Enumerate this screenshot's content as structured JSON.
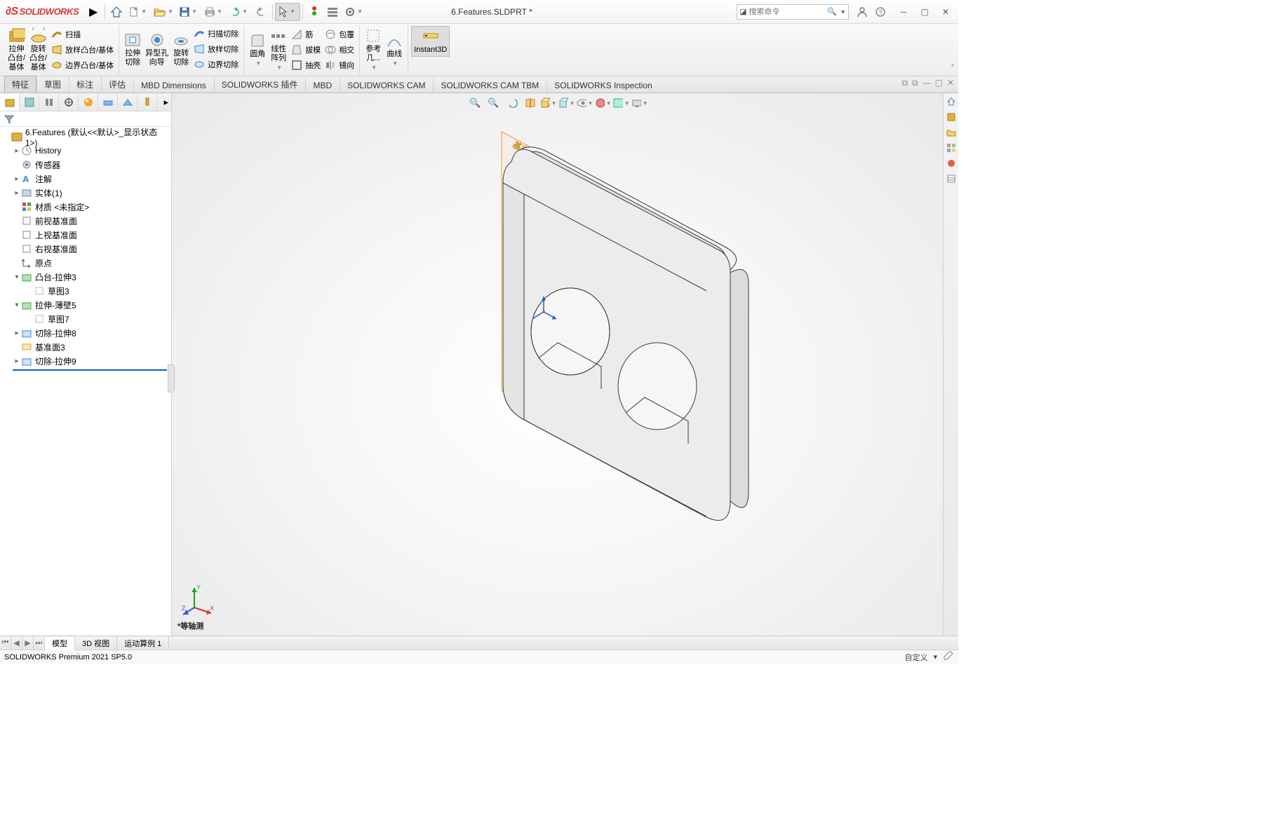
{
  "app": {
    "name": "SOLIDWORKS",
    "doc_title": "6.Features.SLDPRT *"
  },
  "search": {
    "placeholder": "搜索命令"
  },
  "menubar": {},
  "ribbon": {
    "extrude": "拉伸\n凸台/\n基体",
    "revolve": "旋转\n凸台/\n基体",
    "sweep": "扫描",
    "loft": "放样凸台/基体",
    "boundary": "边界凸台/基体",
    "ext_cut": "拉伸\n切除",
    "hole": "异型孔\n向导",
    "rev_cut": "旋转\n切除",
    "sweep_cut": "扫描切除",
    "loft_cut": "放样切除",
    "boundary_cut": "边界切除",
    "fillet": "圆角",
    "lpattern": "线性\n阵列",
    "rib": "筋",
    "draft": "拔模",
    "shell": "抽壳",
    "wrap": "包覆",
    "intersect": "相交",
    "mirror": "镜向",
    "refgeom": "参考\n几...",
    "curves": "曲线",
    "instant3d": "Instant3D"
  },
  "tabs": {
    "t1": "特征",
    "t2": "草图",
    "t3": "标注",
    "t4": "评估",
    "t5": "MBD Dimensions",
    "t6": "SOLIDWORKS 插件",
    "t7": "MBD",
    "t8": "SOLIDWORKS CAM",
    "t9": "SOLIDWORKS CAM TBM",
    "t10": "SOLIDWORKS Inspection"
  },
  "tree": {
    "root": "6.Features  (默认<<默认>_显示状态 1>)",
    "history": "History",
    "sensors": "传感器",
    "annotations": "注解",
    "solid": "实体(1)",
    "material": "材质 <未指定>",
    "front": "前视基准面",
    "top": "上视基准面",
    "right": "右视基准面",
    "origin": "原点",
    "boss3": "凸台-拉伸3",
    "sketch3": "草图3",
    "thin5": "拉伸-薄壁5",
    "sketch7": "草图7",
    "cut8": "切除-拉伸8",
    "plane3": "基准面3",
    "cut9": "切除-拉伸9"
  },
  "viewport": {
    "ref_label": "基准面3",
    "orientation": "*等轴测"
  },
  "bottom": {
    "model": "模型",
    "view3d": "3D 视图",
    "motion": "运动算例 1"
  },
  "status": {
    "left": "SOLIDWORKS Premium 2021 SP5.0",
    "right1": "自定义",
    "arrow": "▾"
  }
}
